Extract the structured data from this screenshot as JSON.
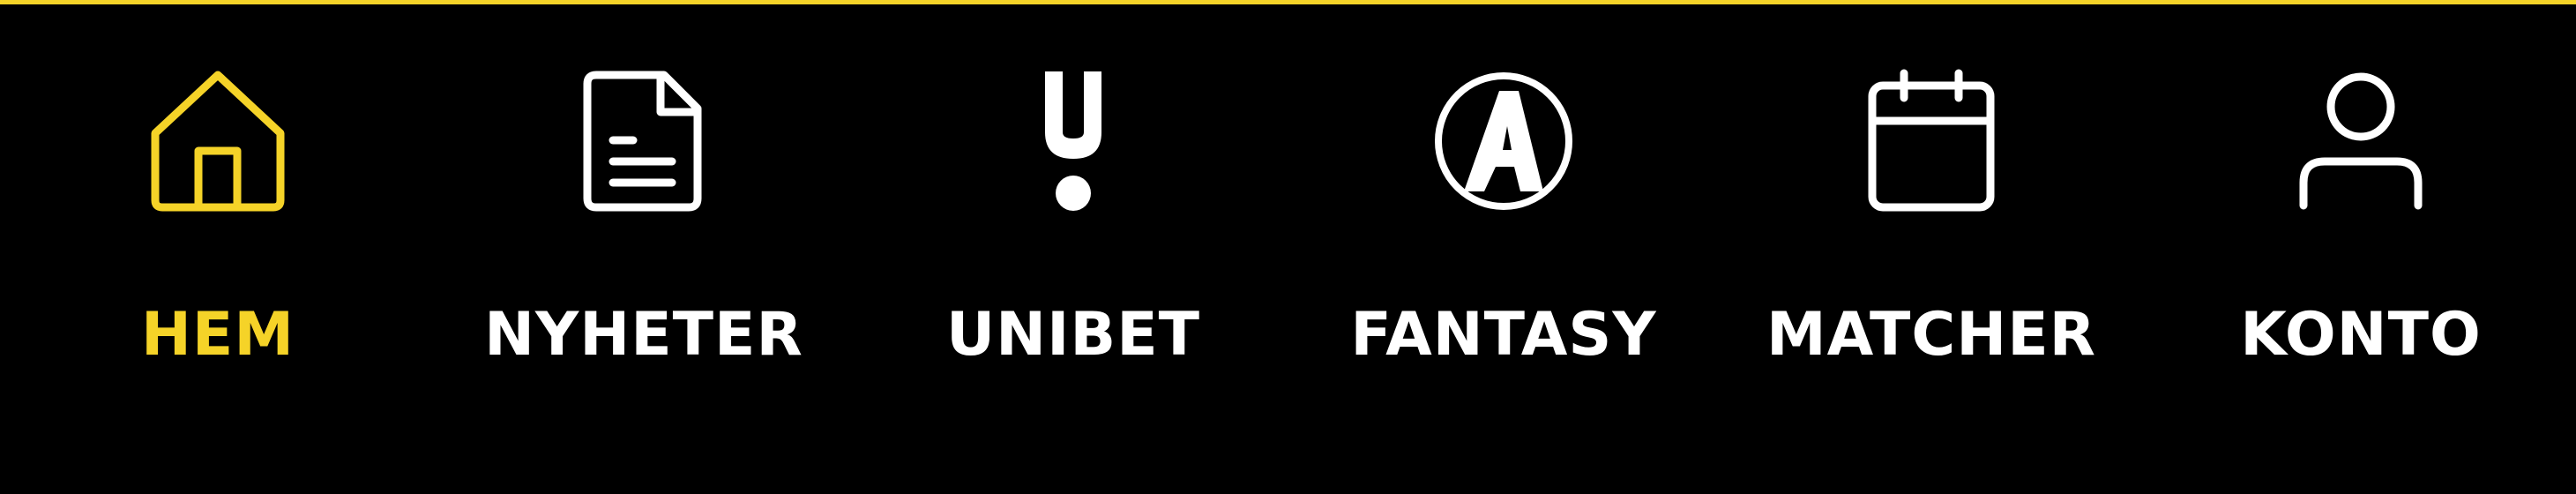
{
  "colors": {
    "background": "#000000",
    "accent": "#f5d328",
    "inactive": "#ffffff"
  },
  "nav": {
    "active_index": 0,
    "items": [
      {
        "label": "HEM",
        "icon": "home-icon"
      },
      {
        "label": "NYHETER",
        "icon": "document-icon"
      },
      {
        "label": "UNIBET",
        "icon": "unibet-logo-icon"
      },
      {
        "label": "FANTASY",
        "icon": "fantasy-logo-icon"
      },
      {
        "label": "MATCHER",
        "icon": "calendar-icon"
      },
      {
        "label": "KONTO",
        "icon": "user-icon"
      }
    ]
  }
}
